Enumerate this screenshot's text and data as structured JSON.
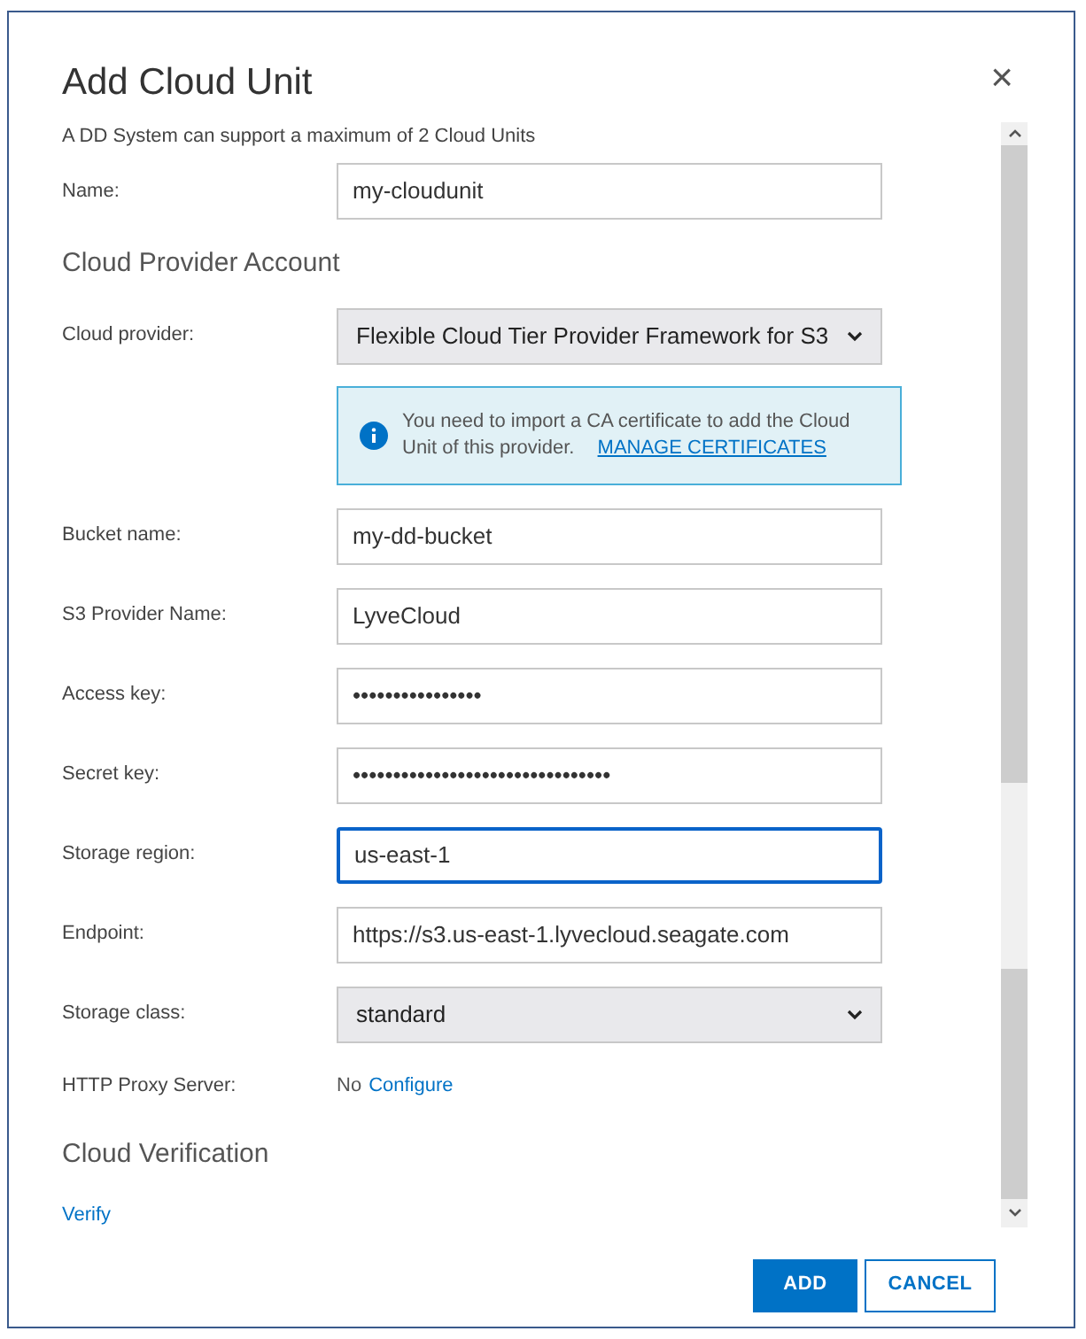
{
  "dialog": {
    "title": "Add Cloud Unit",
    "close": "×",
    "subtitle": "A DD System can support a maximum of 2 Cloud Units"
  },
  "rows": [
    {
      "kind": "text",
      "label": "Name:",
      "value": "my-cloudunit",
      "focused": false
    },
    {
      "kind": "heading",
      "label": "Cloud Provider Account"
    },
    {
      "kind": "select",
      "label": "Cloud provider:",
      "value": "Flexible Cloud Tier Provider Framework for S3"
    },
    {
      "kind": "info",
      "message": "You need to import a CA certificate to add the Cloud Unit of this provider.",
      "link": "MANAGE CERTIFICATES"
    },
    {
      "kind": "text",
      "label": "Bucket name:",
      "value": "my-dd-bucket",
      "focused": false
    },
    {
      "kind": "text",
      "label": "S3 Provider Name:",
      "value": "LyveCloud",
      "focused": false
    },
    {
      "kind": "text",
      "label": "Access key:",
      "value": "••••••••••••••••",
      "focused": false
    },
    {
      "kind": "text",
      "label": "Secret key:",
      "value": "••••••••••••••••••••••••••••••••",
      "focused": false
    },
    {
      "kind": "text",
      "label": "Storage region:",
      "value": "us-east-1",
      "focused": true
    },
    {
      "kind": "text",
      "label": "Endpoint:",
      "value": "https://s3.us-east-1.lyvecloud.seagate.com",
      "focused": false
    },
    {
      "kind": "select",
      "label": "Storage class:",
      "value": "standard"
    },
    {
      "kind": "proxy",
      "label": "HTTP Proxy Server:",
      "value": "No",
      "link": "Configure"
    },
    {
      "kind": "heading",
      "label": "Cloud Verification"
    },
    {
      "kind": "link",
      "label": "Verify"
    }
  ],
  "buttons": [
    {
      "label": "ADD",
      "primary": true
    },
    {
      "label": "CANCEL",
      "primary": false
    }
  ]
}
